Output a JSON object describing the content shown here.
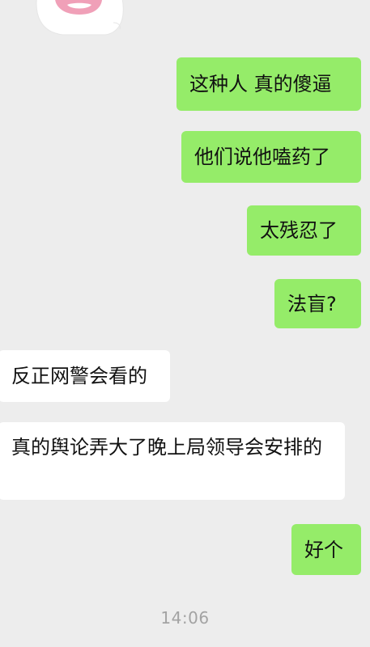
{
  "messages": [
    {
      "side": "mine",
      "text": "这种人 真的傻逼"
    },
    {
      "side": "mine",
      "text": "他们说他嗑药了"
    },
    {
      "side": "mine",
      "text": "太残忍了"
    },
    {
      "side": "mine",
      "text": "法盲?"
    },
    {
      "side": "theirs",
      "text": "反正网警会看的"
    },
    {
      "side": "theirs",
      "text": "真的舆论弄大了晚上局领导会安排的"
    },
    {
      "side": "mine",
      "text": "好个"
    }
  ],
  "timestamp": "14:06",
  "colors": {
    "background": "#ededed",
    "mine_bubble": "#95ec69",
    "theirs_bubble": "#ffffff",
    "timestamp_text": "#a3a3a3"
  },
  "icons": {
    "sticker": "cartoon-bunny-sticker"
  }
}
